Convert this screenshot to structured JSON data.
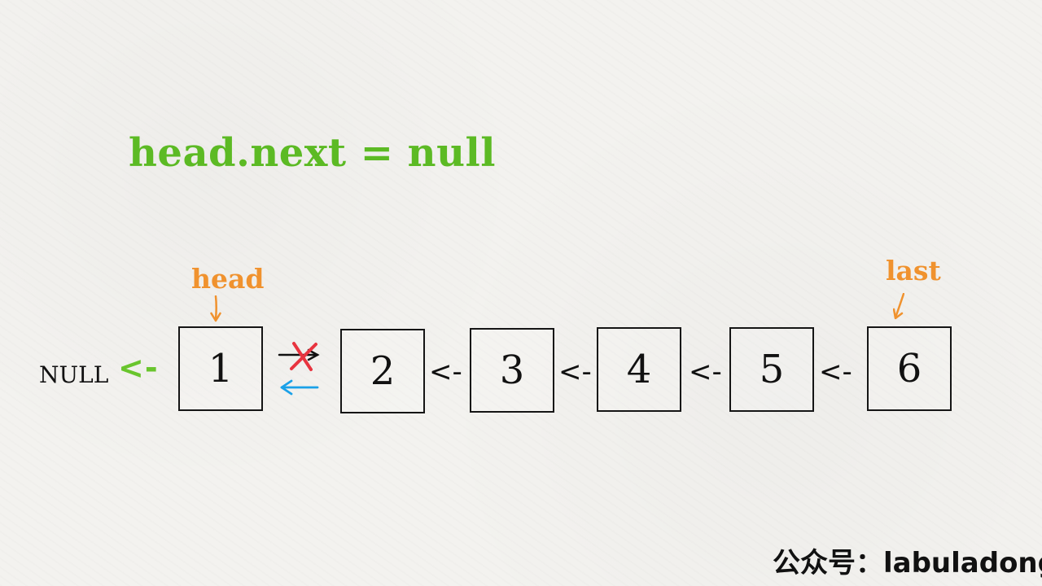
{
  "title": "head.next = null",
  "labels": {
    "head": "head",
    "last": "last",
    "null": "NULL",
    "null_arrow": "<-",
    "link_arrow": "<-"
  },
  "nodes": [
    "1",
    "2",
    "3",
    "4",
    "5",
    "6"
  ],
  "watermark": "公众号：labuladong",
  "colors": {
    "title": "#5cba24",
    "pointer_labels": "#f0922e",
    "null_arrow": "#69c52d",
    "cross_mark": "#e8343f",
    "new_link_arrow": "#1aa1e8"
  }
}
